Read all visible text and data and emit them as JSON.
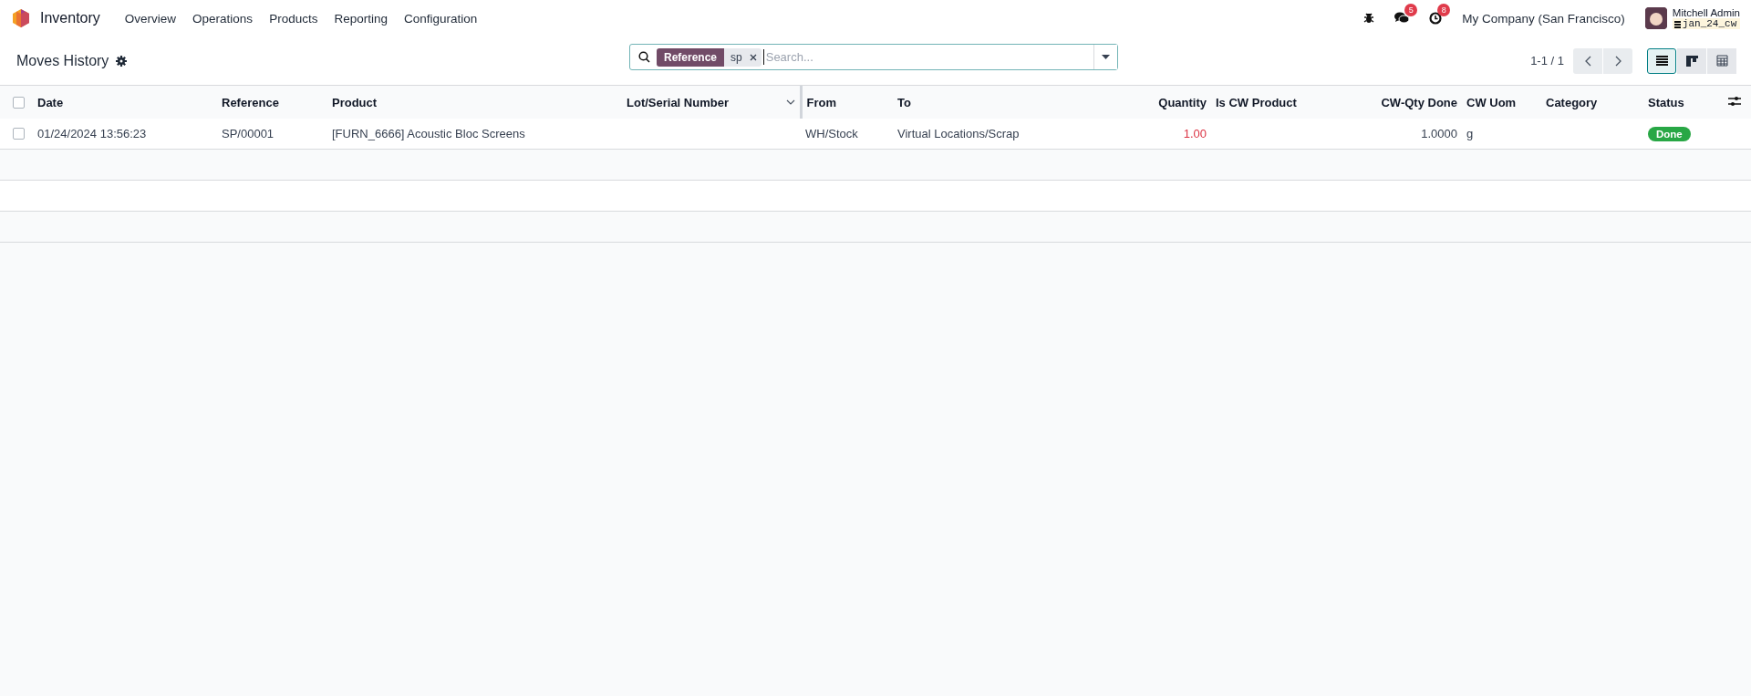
{
  "navbar": {
    "app_name": "Inventory",
    "menu": [
      "Overview",
      "Operations",
      "Products",
      "Reporting",
      "Configuration"
    ],
    "systray": {
      "messages_count": "5",
      "activities_count": "8",
      "company": "My Company (San Francisco)",
      "user_name": "Mitchell Admin",
      "database": "jan_24_cw"
    }
  },
  "control_panel": {
    "title": "Moves History",
    "search": {
      "facet_label": "Reference",
      "facet_value": "sp",
      "placeholder": "Search..."
    },
    "pager": "1-1 / 1",
    "views": [
      {
        "kind": "list",
        "selected": true
      },
      {
        "kind": "kanban",
        "selected": false
      },
      {
        "kind": "pivot",
        "selected": false
      }
    ]
  },
  "table": {
    "select_all": {
      "checked": false
    },
    "columns": [
      {
        "label": "Date"
      },
      {
        "label": "Reference"
      },
      {
        "label": "Product"
      },
      {
        "label": "Lot/Serial Number"
      },
      {
        "label": "From"
      },
      {
        "label": "To"
      },
      {
        "label": "Quantity"
      },
      {
        "label": "Is CW Product"
      },
      {
        "label": "CW-Qty Done"
      },
      {
        "label": "CW Uom"
      },
      {
        "label": "Category"
      },
      {
        "label": "Status"
      }
    ],
    "rows": [
      {
        "checked": false,
        "date": "01/24/2024 13:56:23",
        "reference": "SP/00001",
        "product": "[FURN_6666] Acoustic Bloc Screens",
        "from": "WH/Stock",
        "to": "Virtual Locations/Scrap",
        "quantity": "1.00",
        "quantity_warning": true,
        "cw_qty_done": "1.0000",
        "cw_uom": "g",
        "status": {
          "label": "Done",
          "kind": "success"
        }
      }
    ]
  }
}
